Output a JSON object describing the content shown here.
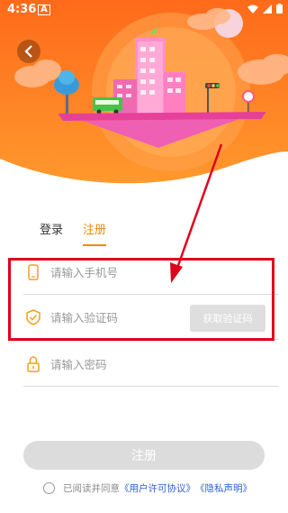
{
  "status": {
    "time": "4:36",
    "app_glyph": "A"
  },
  "tabs": {
    "login": "登录",
    "register": "注册"
  },
  "form": {
    "phone_placeholder": "请输入手机号",
    "code_placeholder": "请输入验证码",
    "get_code_label": "获取验证码",
    "password_placeholder": "请输入密码"
  },
  "submit_label": "注册",
  "agreement": {
    "prefix": "已阅读并同意",
    "terms": "《用户许可协议》",
    "privacy": "《隐私声明》"
  },
  "colors": {
    "accent": "#f08a00",
    "highlight": "#e0001b",
    "hero": "#fb7c1e"
  }
}
